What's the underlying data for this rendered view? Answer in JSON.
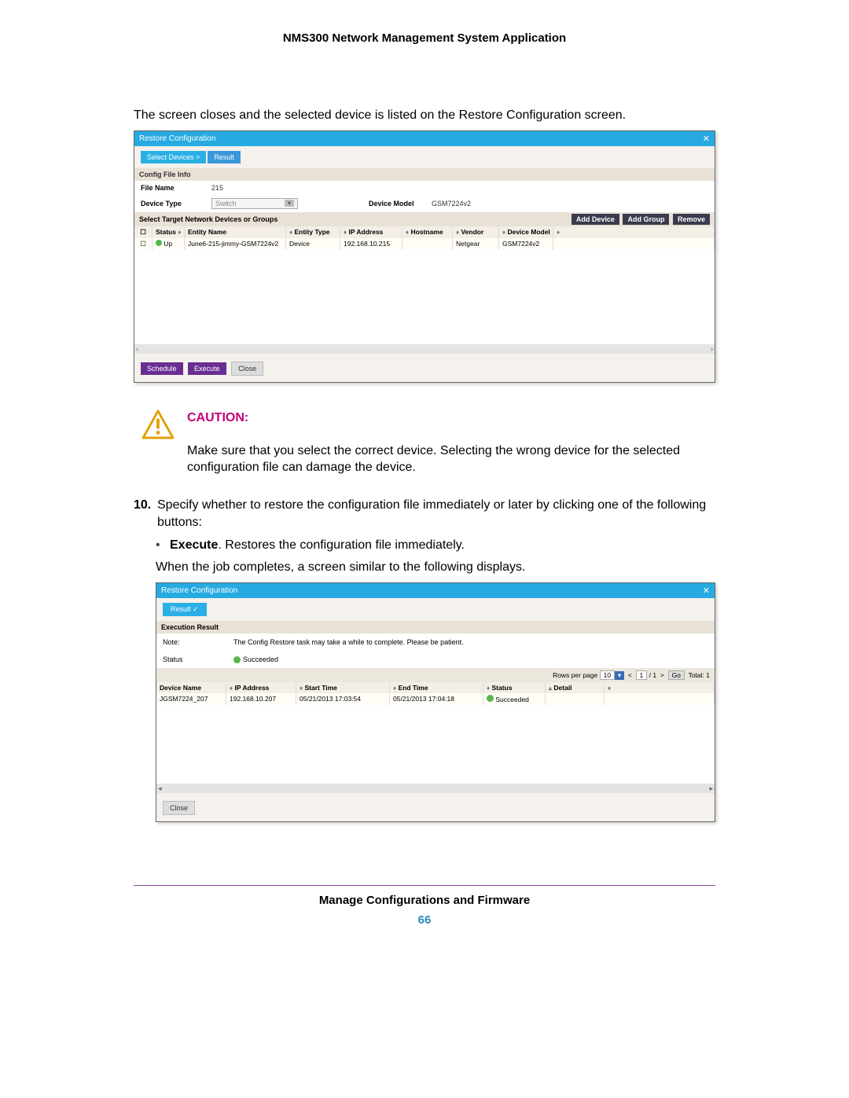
{
  "doc": {
    "header": "NMS300 Network Management System Application",
    "footer": "Manage Configurations and Firmware",
    "page_number": "66"
  },
  "text": {
    "intro": "The screen closes and the selected device is listed on the Restore Configuration screen.",
    "caution_title": "CAUTION:",
    "caution_body": "Make sure that you select the correct device. Selecting the wrong device for the selected configuration file can damage the device.",
    "step10_num": "10.",
    "step10": "Specify whether to restore the configuration file immediately or later by clicking one of the following buttons:",
    "bullet_dot": "•",
    "bullet_label": "Execute",
    "bullet_rest": ". Restores the configuration file immediately.",
    "after_exec": "When the job completes, a screen similar to the following displays."
  },
  "ss1": {
    "title": "Restore Configuration",
    "close_glyph": "✕",
    "tabs": {
      "a": "Select Devices  >",
      "b": "Result"
    },
    "section_info": "Config File Info",
    "file_name_lbl": "File Name",
    "file_name_val": "215",
    "device_type_lbl": "Device Type",
    "device_type_val": "Switch",
    "device_model_lbl": "Device Model",
    "device_model_val": "GSM7224v2",
    "select_target": "Select Target Network Devices or Groups",
    "btn_add_device": "Add Device",
    "btn_add_group": "Add Group",
    "btn_remove": "Remove",
    "cols": {
      "status": "Status",
      "entity_name": "Entity Name",
      "entity_type": "Entity Type",
      "ip": "IP Address",
      "hostname": "Hostname",
      "vendor": "Vendor",
      "device_model": "Device Model"
    },
    "row": {
      "status": "Up",
      "entity_name": "June6-215-jimmy-GSM7224v2",
      "entity_type": "Device",
      "ip": "192.168.10.215",
      "hostname": "",
      "vendor": "Netgear",
      "device_model": "GSM7224v2"
    },
    "scroll_left": "‹",
    "scroll_right": "›",
    "btn_schedule": "Schedule",
    "btn_execute": "Execute",
    "btn_close": "Close"
  },
  "ss2": {
    "title": "Restore Configuration",
    "close_glyph": "✕",
    "tab_result": "Result ✓",
    "section": "Execution Result",
    "note_lbl": "Note:",
    "note_val": "The Config Restore task may take a while to complete. Please be patient.",
    "status_lbl": "Status",
    "status_val": "Succeeded",
    "pager": {
      "rows_lbl": "Rows per page",
      "rows_val": "10",
      "prev": "<",
      "page": "1",
      "pages": "/ 1",
      "next": ">",
      "go": "Go",
      "total": "Total: 1"
    },
    "cols": {
      "device_name": "Device Name",
      "ip": "IP Address",
      "start": "Start Time",
      "end": "End Time",
      "status": "Status",
      "detail": "Detail"
    },
    "row": {
      "device_name": "JGSM7224_207",
      "ip": "192.168.10.207",
      "start": "05/21/2013 17:03:54",
      "end": "05/21/2013 17:04:18",
      "status": "Succeeded",
      "detail": ""
    },
    "btn_close": "Close"
  }
}
